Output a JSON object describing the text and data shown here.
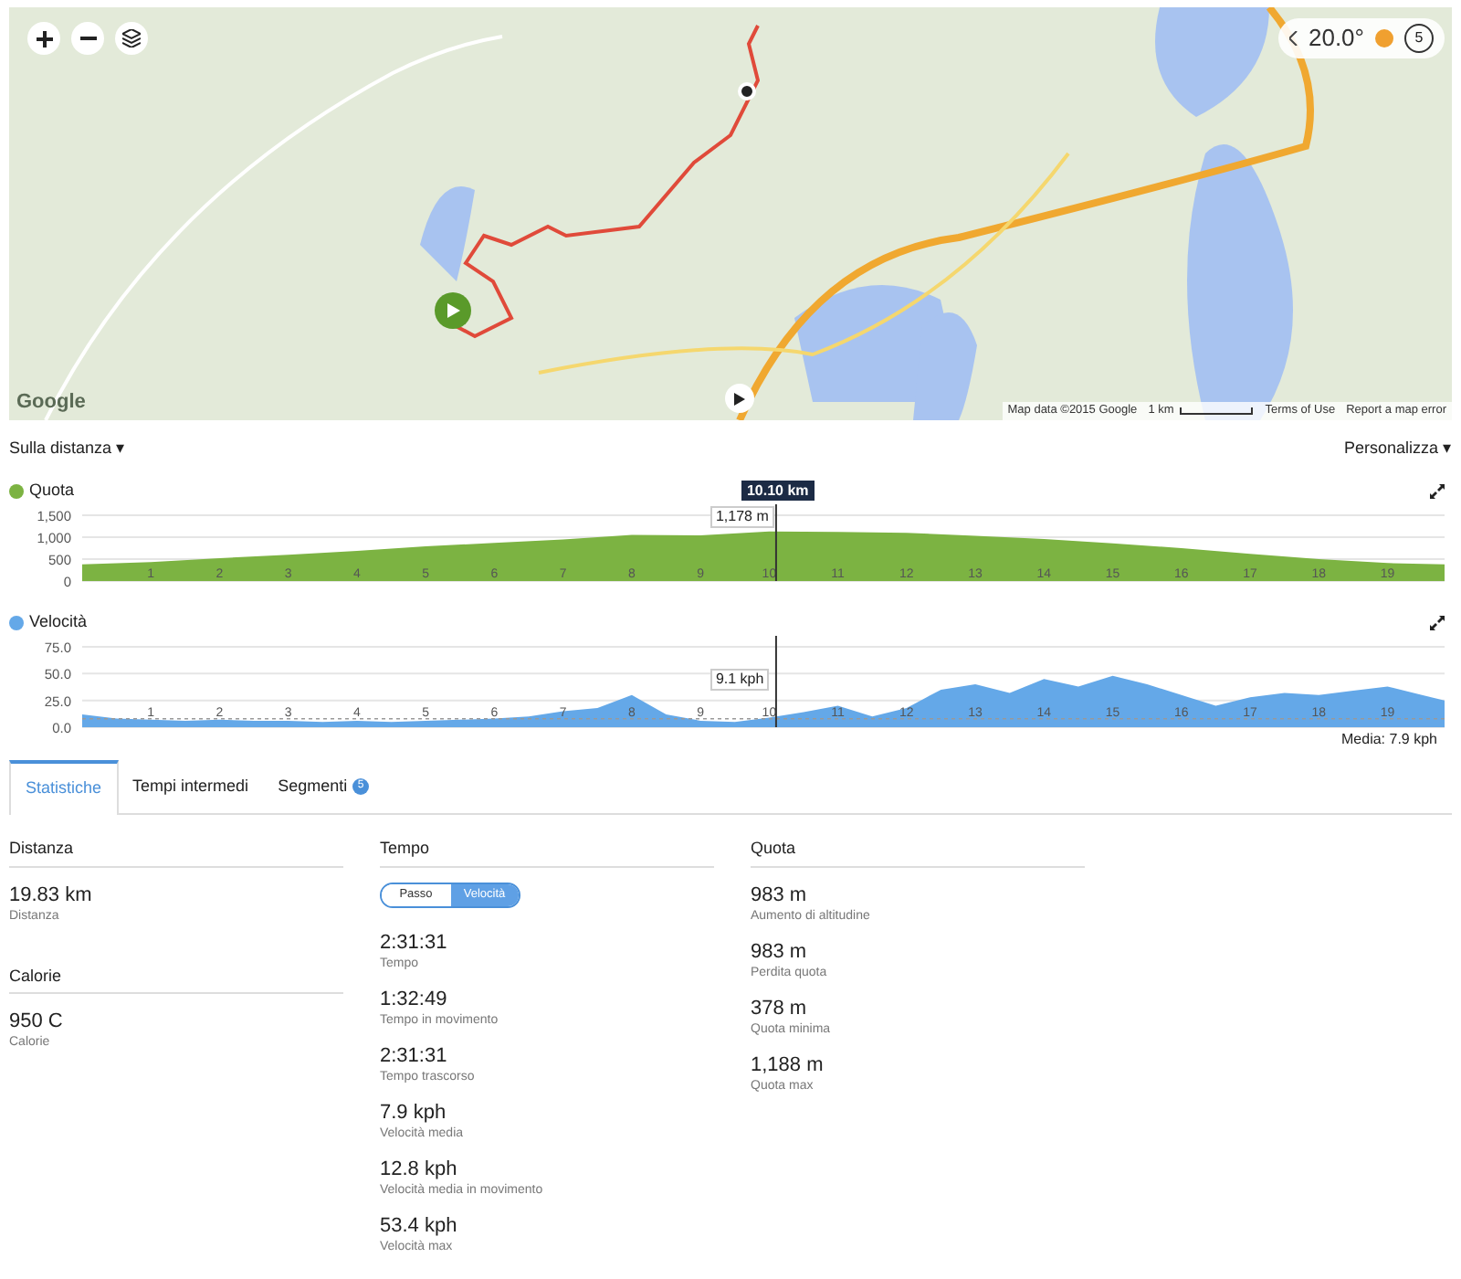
{
  "map": {
    "weather": {
      "temperature": "20.0°",
      "wind": "5"
    },
    "logo": "Google",
    "attribution": "Map data ©2015 Google",
    "scale": "1 km",
    "terms_link": "Terms of Use",
    "report_link": "Report a map error"
  },
  "toolbar": {
    "x_axis_menu": "Sulla distanza ▾",
    "customize_menu": "Personalizza ▾"
  },
  "elevation": {
    "color": "#7cb342",
    "cursor_label": "10.10 km",
    "tooltip": "1,178 m",
    "chart_data": {
      "type": "area",
      "title": "Quota",
      "x": [
        0,
        1,
        2,
        3,
        4,
        5,
        6,
        7,
        8,
        9,
        10,
        11,
        12,
        13,
        14,
        15,
        16,
        17,
        18,
        19,
        19.83
      ],
      "series": [
        {
          "color": "#7cb342",
          "values": [
            380,
            430,
            520,
            600,
            690,
            790,
            870,
            950,
            1050,
            1040,
            1130,
            1120,
            1100,
            1030,
            960,
            860,
            750,
            620,
            500,
            410,
            380
          ]
        }
      ],
      "xlim": [
        0,
        19.83
      ],
      "ylim": [
        0,
        1500
      ],
      "xticks": [
        1,
        2,
        3,
        4,
        5,
        6,
        7,
        8,
        9,
        10,
        11,
        12,
        13,
        14,
        15,
        16,
        17,
        18,
        19
      ],
      "yticks": [
        0,
        {
          "value": 500,
          "label": "500"
        },
        {
          "value": 1000,
          "label": "1,000"
        },
        {
          "value": 1500,
          "label": "1,500"
        }
      ],
      "ref_lines": [
        {
          "axis": "x",
          "value": 10.1
        }
      ]
    }
  },
  "speed": {
    "color": "#64a8e8",
    "tooltip": "9.1 kph",
    "chart_data": {
      "type": "area",
      "title": "Velocità",
      "x": [
        0,
        0.5,
        1,
        1.5,
        2,
        2.5,
        3,
        3.5,
        4,
        4.5,
        5,
        5.5,
        6,
        6.5,
        7,
        7.5,
        8,
        8.5,
        9,
        9.5,
        10,
        10.5,
        11,
        11.5,
        12,
        12.5,
        13,
        13.5,
        14,
        14.5,
        15,
        15.5,
        16,
        16.5,
        17,
        17.5,
        18,
        18.5,
        19,
        19.5,
        19.83
      ],
      "series": [
        {
          "color": "#64a8e8",
          "values": [
            12,
            8,
            7,
            6,
            7,
            6,
            6,
            5,
            6,
            5,
            6,
            7,
            8,
            10,
            15,
            18,
            30,
            12,
            6,
            5,
            9,
            14,
            20,
            10,
            18,
            35,
            40,
            32,
            45,
            38,
            48,
            40,
            30,
            20,
            28,
            32,
            30,
            34,
            38,
            30,
            25
          ]
        }
      ],
      "xlim": [
        0,
        19.83
      ],
      "ylim": [
        0,
        75
      ],
      "xticks": [
        1,
        2,
        3,
        4,
        5,
        6,
        7,
        8,
        9,
        10,
        11,
        12,
        13,
        14,
        15,
        16,
        17,
        18,
        19
      ],
      "yticks": [
        {
          "value": 0,
          "label": "0.0"
        },
        {
          "value": 25,
          "label": "25.0"
        },
        {
          "value": 50,
          "label": "50.0"
        },
        {
          "value": 75,
          "label": "75.0"
        }
      ],
      "ref_lines": [
        {
          "axis": "y",
          "value": 7.9,
          "label": "Media: 7.9 kph"
        },
        {
          "axis": "x",
          "value": 10.1
        }
      ]
    }
  },
  "tabs": [
    {
      "label": "Statistiche",
      "selected": true
    },
    {
      "label": "Tempi intermedi",
      "selected": false
    },
    {
      "label": "Segmenti",
      "selected": false,
      "badge": "5"
    }
  ],
  "columns": [
    {
      "sections": [
        {
          "title": "Distanza",
          "stats": [
            {
              "value": "19.83 km",
              "label": "Distanza"
            }
          ]
        },
        {
          "title": "Calorie",
          "stats": [
            {
              "value": "950 C",
              "label": "Calorie"
            }
          ]
        }
      ]
    },
    {
      "sections": [
        {
          "title": "Tempo",
          "toggle": [
            {
              "label": "Passo",
              "selected": false
            },
            {
              "label": "Velocità",
              "selected": true
            }
          ],
          "stats": [
            {
              "value": "2:31:31",
              "label": "Tempo"
            },
            {
              "value": "1:32:49",
              "label": "Tempo in movimento"
            },
            {
              "value": "2:31:31",
              "label": "Tempo trascorso"
            },
            {
              "value": "7.9 kph",
              "label": "Velocità media"
            },
            {
              "value": "12.8 kph",
              "label": "Velocità media in movimento"
            },
            {
              "value": "53.4 kph",
              "label": "Velocità max"
            }
          ]
        }
      ]
    },
    {
      "sections": [
        {
          "title": "Quota",
          "stats": [
            {
              "value": "983 m",
              "label": "Aumento di altitudine"
            },
            {
              "value": "983 m",
              "label": "Perdita quota"
            },
            {
              "value": "378 m",
              "label": "Quota minima"
            },
            {
              "value": "1,188 m",
              "label": "Quota max"
            }
          ]
        }
      ]
    }
  ]
}
